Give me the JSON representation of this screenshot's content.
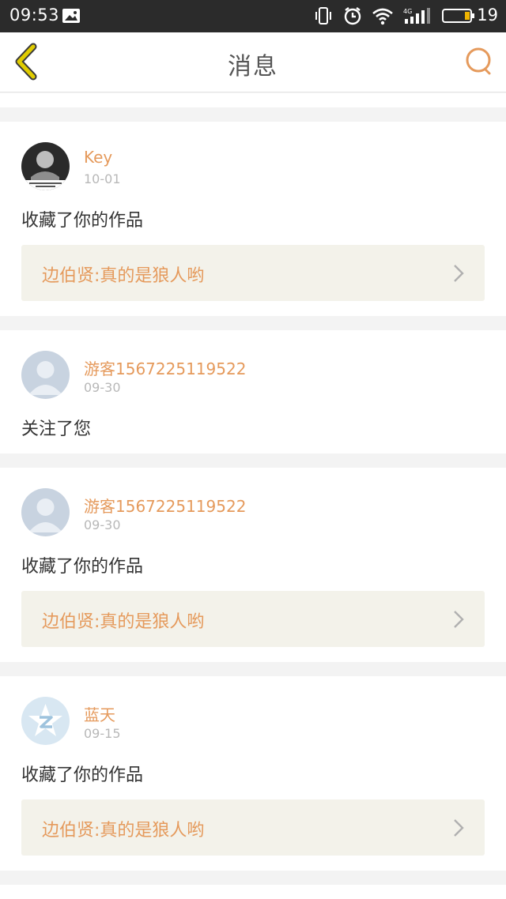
{
  "status_bar": {
    "time": "09:53",
    "battery_level": "19",
    "icons": [
      "image-notification-icon",
      "vibrate-icon",
      "alarm-icon",
      "wifi-icon",
      "signal-4g-icon",
      "battery-icon"
    ]
  },
  "header": {
    "title": "消息",
    "back_icon": "chevron-left-icon",
    "search_icon": "search-icon"
  },
  "colors": {
    "accent": "#e59a5c",
    "back_arrow": "#d9c000",
    "link_bg": "#f3f2ea",
    "divider": "#f3f3f3"
  },
  "messages": [
    {
      "user": "Key",
      "date": "10-01",
      "action": "收藏了你的作品",
      "work": "边伯贤:真的是狼人哟",
      "avatar": "photo-avatar"
    },
    {
      "user": "游客1567225119522",
      "date": "09-30",
      "action": "关注了您",
      "work": null,
      "avatar": "default-user-avatar"
    },
    {
      "user": "游客1567225119522",
      "date": "09-30",
      "action": "收藏了你的作品",
      "work": "边伯贤:真的是狼人哟",
      "avatar": "default-user-avatar"
    },
    {
      "user": "蓝天",
      "date": "09-15",
      "action": "收藏了你的作品",
      "work": "边伯贤:真的是狼人哟",
      "avatar": "qq-star-avatar"
    }
  ]
}
